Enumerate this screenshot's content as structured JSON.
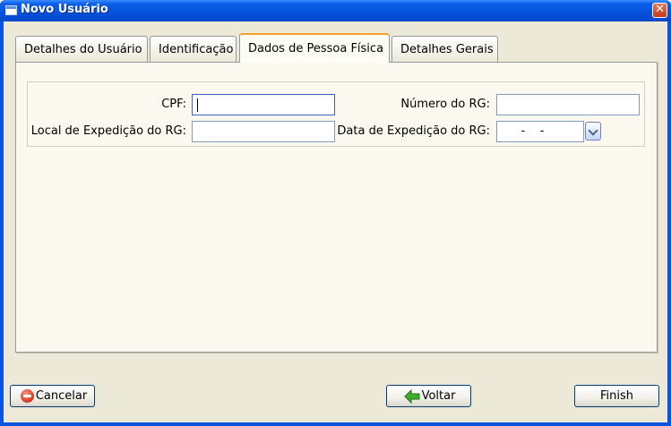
{
  "window": {
    "title": "Novo Usuário",
    "close_glyph": "✕"
  },
  "tabs": [
    {
      "label": "Detalhes do Usuário",
      "active": false
    },
    {
      "label": "Identificação",
      "active": false
    },
    {
      "label": "Dados de Pessoa Física",
      "active": true
    },
    {
      "label": "Detalhes Gerais",
      "active": false
    }
  ],
  "form": {
    "cpf_label": "CPF:",
    "cpf_value": "",
    "rg_number_label": "Número do RG:",
    "rg_number_value": "",
    "rg_issuer_label": "Local de Expedição do RG:",
    "rg_issuer_value": "",
    "rg_date_label": "Data de Expedição do RG:",
    "rg_date_value": "    -    -"
  },
  "buttons": {
    "cancel_label": "Cancelar",
    "back_label": "Voltar",
    "finish_label": "Finish"
  },
  "colors": {
    "title_bar": "#0a55e0",
    "panel": "#fbf9ef",
    "active_tab_accent": "#f5a326"
  }
}
